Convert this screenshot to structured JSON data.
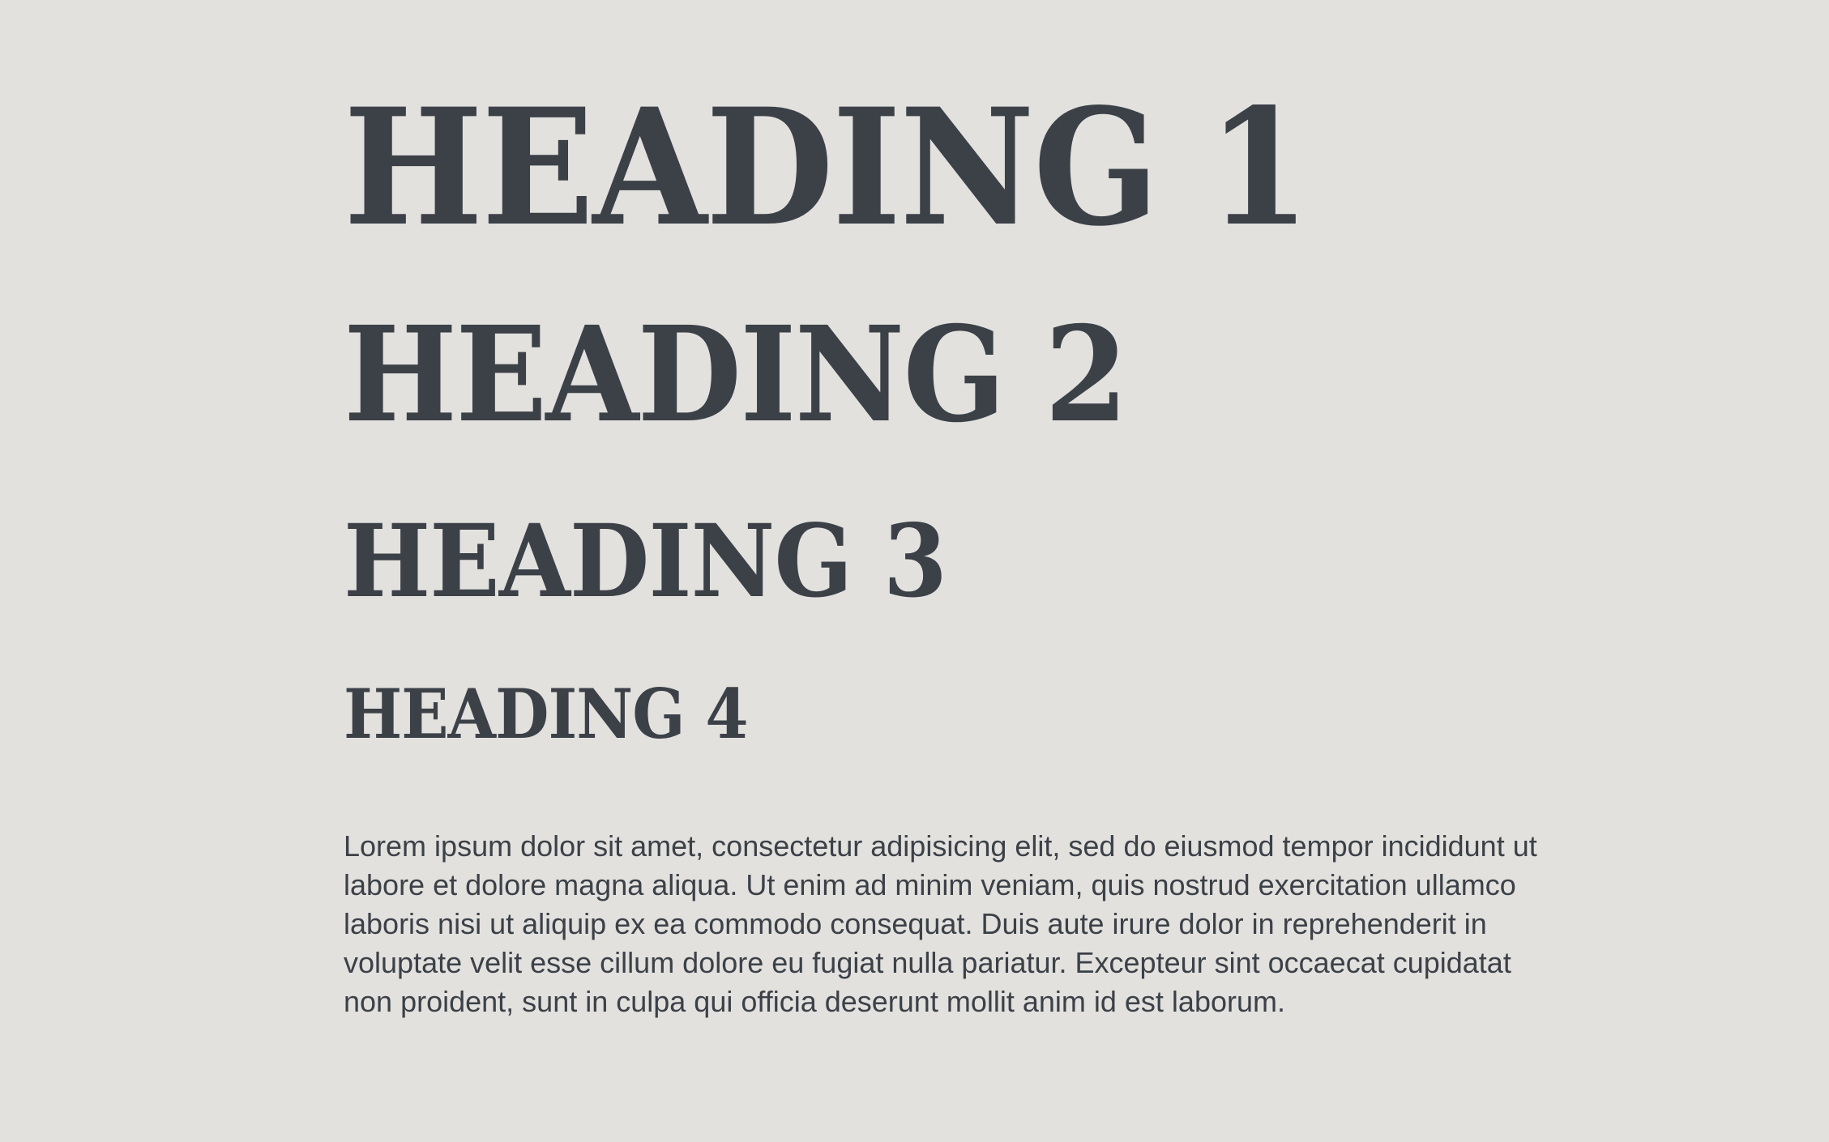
{
  "page": {
    "background": "#e2e1de",
    "text_color": "#3c4148"
  },
  "headings": {
    "h1": "HEADING 1",
    "h2": "HEADING 2",
    "h3": "HEADING 3",
    "h4": "HEADING 4"
  },
  "body": {
    "paragraph": "Lorem ipsum dolor sit amet, consectetur adipisicing elit, sed do eiusmod tempor incididunt ut labore et dolore magna aliqua. Ut enim ad minim veniam, quis nostrud exercitation ullamco laboris nisi ut aliquip ex ea commodo consequat. Duis aute irure dolor in reprehenderit in voluptate velit esse cillum dolore eu fugiat nulla pariatur. Excepteur sint occaecat cupidatat non proident, sunt in culpa qui officia deserunt mollit anim id est laborum."
  }
}
